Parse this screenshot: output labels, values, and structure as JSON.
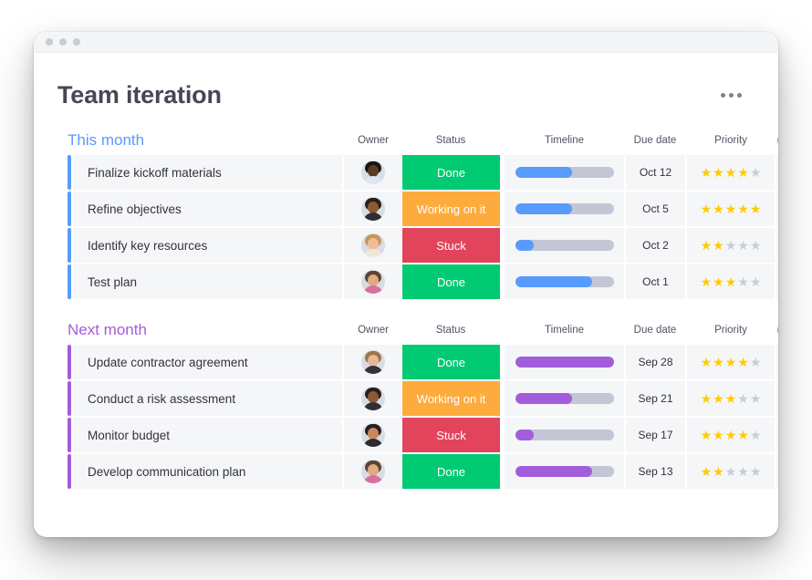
{
  "window": {
    "traffic_dots": 3
  },
  "header": {
    "title": "Team iteration",
    "menu_icon": "kebab-menu-icon"
  },
  "columns": {
    "owner": "Owner",
    "status": "Status",
    "timeline": "Timeline",
    "due_date": "Due date",
    "priority": "Priority",
    "add": "+"
  },
  "colors": {
    "accent_blue": "#579bfc",
    "accent_purple": "#a25ddc",
    "status_done": "#00ca72",
    "status_working": "#fdab3d",
    "status_stuck": "#e2445c",
    "star_on": "#ffcb00",
    "star_off": "#c9ccd4",
    "cell_bg": "#f5f6f8",
    "track": "#c3c6d4"
  },
  "groups": [
    {
      "title": "This month",
      "color": "blue",
      "rows": [
        {
          "name": "Finalize kickoff materials",
          "status": "Done",
          "status_key": "done",
          "progress": 58,
          "due_date": "Oct 12",
          "priority": 4,
          "avatar": {
            "skin": "#5d3a23",
            "hair": "#161616",
            "shirt": "#dfe6f2"
          }
        },
        {
          "name": "Refine objectives",
          "status": "Working on it",
          "status_key": "working",
          "progress": 58,
          "due_date": "Oct 5",
          "priority": 5,
          "avatar": {
            "skin": "#8a5a36",
            "hair": "#2a2018",
            "shirt": "#2e2e33"
          }
        },
        {
          "name": "Identify key resources",
          "status": "Stuck",
          "status_key": "stuck",
          "progress": 19,
          "due_date": "Oct 2",
          "priority": 2,
          "avatar": {
            "skin": "#edbd97",
            "hair": "#c89558",
            "shirt": "#f0e7d8"
          }
        },
        {
          "name": "Test plan",
          "status": "Done",
          "status_key": "done",
          "progress": 78,
          "due_date": "Oct 1",
          "priority": 3,
          "avatar": {
            "skin": "#e0ab82",
            "hair": "#5a4433",
            "shirt": "#d86fa0"
          }
        }
      ]
    },
    {
      "title": "Next month",
      "color": "purple",
      "rows": [
        {
          "name": "Update contractor agreement",
          "status": "Done",
          "status_key": "done",
          "progress": 100,
          "due_date": "Sep 28",
          "priority": 4,
          "avatar": {
            "skin": "#e8b894",
            "hair": "#9b7748",
            "shirt": "#33343a"
          }
        },
        {
          "name": "Conduct a risk assessment",
          "status": "Working on it",
          "status_key": "working",
          "progress": 58,
          "due_date": "Sep 21",
          "priority": 3,
          "avatar": {
            "skin": "#8a5a36",
            "hair": "#2a2018",
            "shirt": "#2e2e33"
          }
        },
        {
          "name": "Monitor budget",
          "status": "Stuck",
          "status_key": "stuck",
          "progress": 19,
          "due_date": "Sep 17",
          "priority": 4,
          "avatar": {
            "skin": "#c9865c",
            "hair": "#22201f",
            "shirt": "#2b2b30"
          }
        },
        {
          "name": "Develop communication plan",
          "status": "Done",
          "status_key": "done",
          "progress": 78,
          "due_date": "Sep 13",
          "priority": 2,
          "avatar": {
            "skin": "#e0ab82",
            "hair": "#5a4433",
            "shirt": "#d86fa0"
          }
        }
      ]
    }
  ]
}
